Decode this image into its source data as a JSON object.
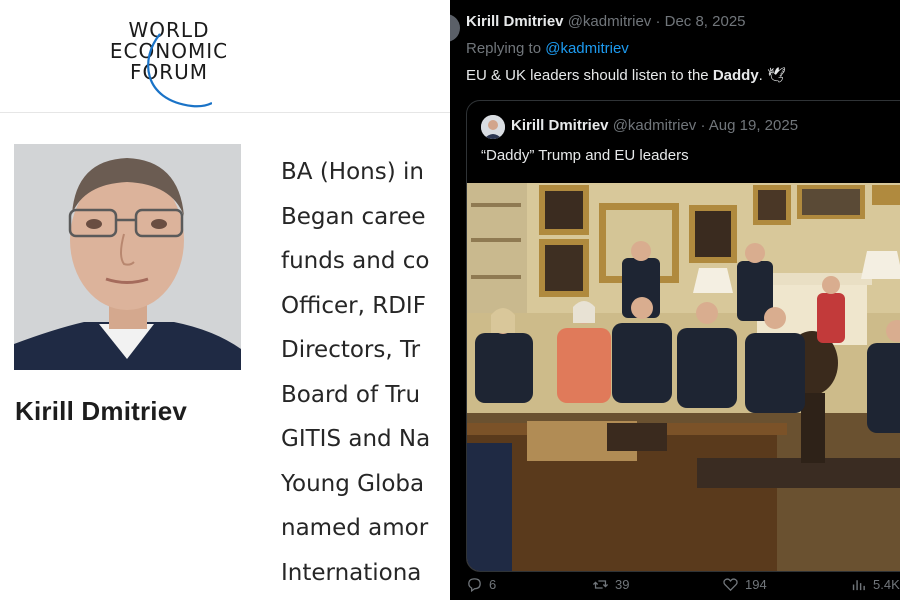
{
  "wef": {
    "logo_lines": [
      "WORLD",
      "ECONOMIC",
      "FORUM"
    ],
    "profile_name": "Kirill Dmitriev",
    "bio_lines": [
      "BA (Hons) in",
      "Began caree",
      "funds and co",
      "Officer, RDIF",
      "Directors, Tr",
      "Board of Tru",
      "GITIS and Na",
      "Young Globa",
      "named amor",
      "Internationa"
    ]
  },
  "tweet": {
    "author": "Kirill Dmitriev",
    "handle": "@kadmitriev",
    "separator": "·",
    "date": "Dec 8, 2025",
    "replying_prefix": "Replying to",
    "replying_handle": "@kadmitriev",
    "text_before": "EU & UK leaders should listen to the",
    "text_bold": "Daddy",
    "text_after": ".",
    "emoji": "🕊",
    "quote": {
      "author": "Kirill Dmitriev",
      "handle": "@kadmitriev",
      "separator": "·",
      "date": "Aug 19, 2025",
      "text": "“Daddy” Trump and EU leaders"
    },
    "actions": {
      "replies": "6",
      "reposts": "39",
      "likes": "194",
      "views": "5.4K"
    }
  },
  "colors": {
    "x_background": "#000000",
    "x_text": "#e7e9ea",
    "x_muted": "#71767b",
    "x_link": "#1d9bf0",
    "wef_swoosh": "#1a73c7"
  }
}
